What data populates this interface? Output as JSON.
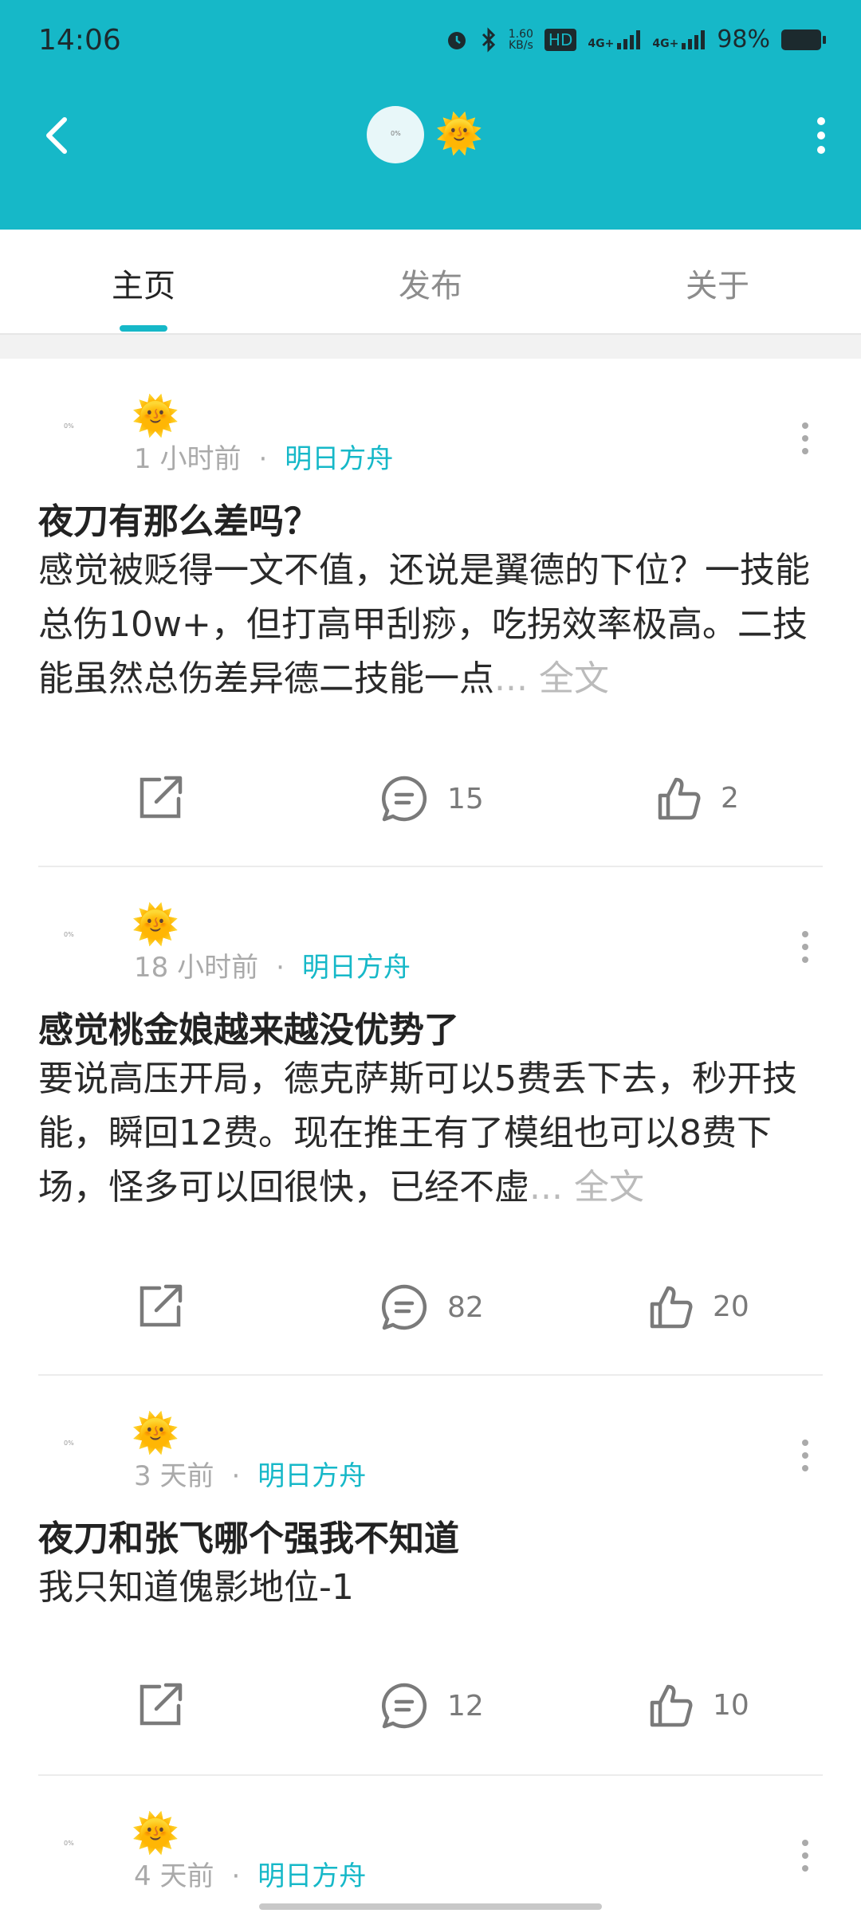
{
  "status_bar": {
    "time": "14:06",
    "speed_top": "1.60",
    "speed_bottom": "KB/s",
    "hd": "HD",
    "net1": "4G+",
    "net2": "4G+",
    "battery": "98%"
  },
  "header": {
    "avatar_text": "0%",
    "emoji": "🌞"
  },
  "tabs": [
    {
      "label": "主页"
    },
    {
      "label": "发布"
    },
    {
      "label": "关于"
    }
  ],
  "posts": [
    {
      "avatar_text": "0%",
      "emoji": "🌞",
      "time": "1 小时前",
      "dot": "·",
      "game": "明日方舟",
      "title": "夜刀有那么差吗？",
      "content": "感觉被贬得一文不值，还说是翼德的下位？一技能总伤10w+，但打高甲刮痧，吃拐效率极高。二技能虽然总伤差异德二技能一点",
      "ellipsis": "... 全文",
      "comments": "15",
      "likes": "2"
    },
    {
      "avatar_text": "0%",
      "emoji": "🌞",
      "time": "18 小时前",
      "dot": "·",
      "game": "明日方舟",
      "title": "感觉桃金娘越来越没优势了",
      "content": "要说高压开局，德克萨斯可以5费丢下去，秒开技能，瞬回12费。现在推王有了模组也可以8费下场，怪多可以回很快，已经不虚",
      "ellipsis": "... 全文",
      "comments": "82",
      "likes": "20"
    },
    {
      "avatar_text": "0%",
      "emoji": "🌞",
      "time": "3 天前",
      "dot": "·",
      "game": "明日方舟",
      "title": "夜刀和张飞哪个强我不知道",
      "content": "我只知道傀影地位-1",
      "ellipsis": "",
      "comments": "12",
      "likes": "10"
    },
    {
      "avatar_text": "0%",
      "emoji": "🌞",
      "time": "4 天前",
      "dot": "·",
      "game": "明日方舟"
    }
  ]
}
